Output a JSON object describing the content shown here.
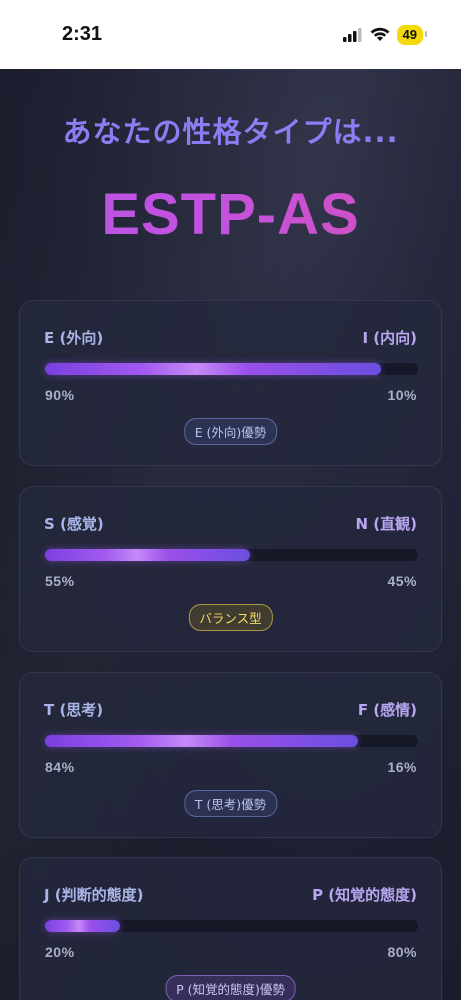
{
  "status_bar": {
    "time": "2:31",
    "battery": "49"
  },
  "header": {
    "headline": "あなたの性格タイプは...",
    "type_code": "ESTP-AS"
  },
  "dimensions": [
    {
      "left_label": "E (外向)",
      "right_label": "I (内向)",
      "left_pct_text": "90%",
      "right_pct_text": "10%",
      "left_fraction": 0.9,
      "badge": "E (外向)優勢"
    },
    {
      "left_label": "S (感覚)",
      "right_label": "N (直観)",
      "left_pct_text": "55%",
      "right_pct_text": "45%",
      "left_fraction": 0.55,
      "badge": "バランス型"
    },
    {
      "left_label": "T (思考)",
      "right_label": "F (感情)",
      "left_pct_text": "84%",
      "right_pct_text": "16%",
      "left_fraction": 0.84,
      "badge": "T (思考)優勢"
    },
    {
      "left_label": "J (判断的態度)",
      "right_label": "P (知覚的態度)",
      "left_pct_text": "20%",
      "right_pct_text": "80%",
      "left_fraction": 0.2,
      "badge": "P (知覚的態度)優勢"
    }
  ],
  "colors": {
    "headline": "#8d7cf2",
    "type_code_gradient_start": "#b455e8",
    "type_code_gradient_end": "#d94fb6",
    "balance_badge": "#f2d96a"
  },
  "icons": [
    "signal-icon",
    "wifi-icon",
    "battery-icon"
  ]
}
